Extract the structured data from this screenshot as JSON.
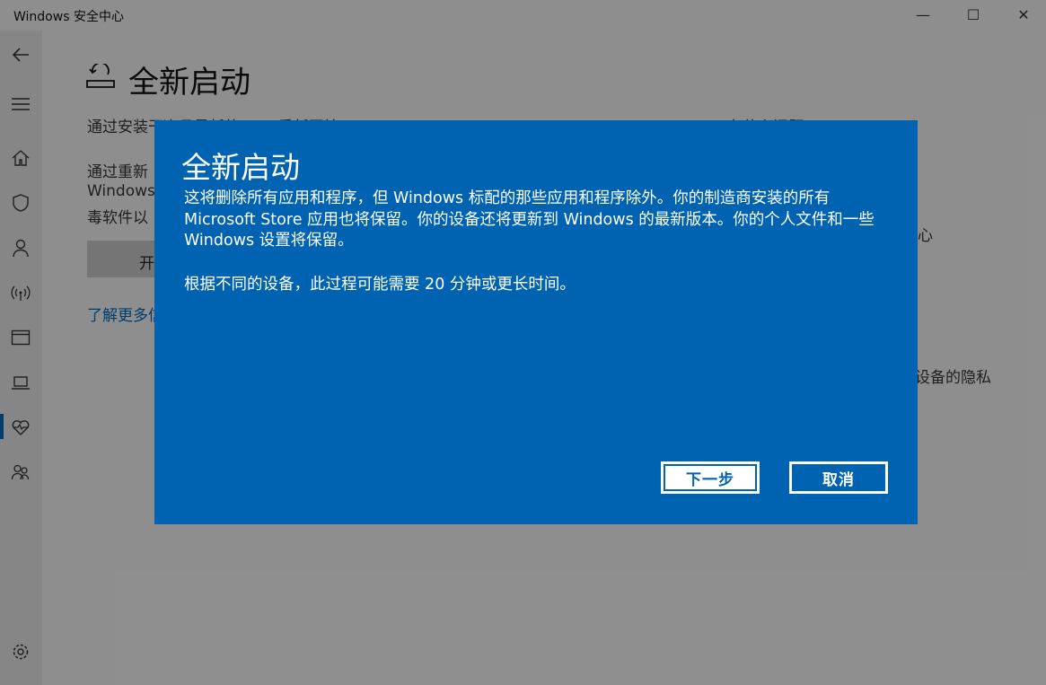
{
  "window": {
    "title": "Windows 安全中心"
  },
  "controls": {
    "minimize": "—",
    "maximize": "☐",
    "close": "✕"
  },
  "page": {
    "title": "全新启动",
    "line1": "通过安装干净且最新的 Win    重新开始",
    "line2_a": "通过重新",
    "line2_b": "Windows",
    "line2_c": "毒软件以",
    "start_button": "开",
    "learn_more": "了解更多信",
    "right_1": "有什么问题",
    "right_2": "心",
    "right_3": "设备的隐私"
  },
  "dialog": {
    "title": "全新启动",
    "body": "这将删除所有应用和程序，但 Windows 标配的那些应用和程序除外。你的制造商安装的所有 Microsoft Store 应用也将保留。你的设备还将更新到 Windows 的最新版本。你的个人文件和一些 Windows 设置将保留。",
    "note": "根据不同的设备，此过程可能需要 20 分钟或更长时间。",
    "next": "下一步",
    "cancel": "取消"
  }
}
